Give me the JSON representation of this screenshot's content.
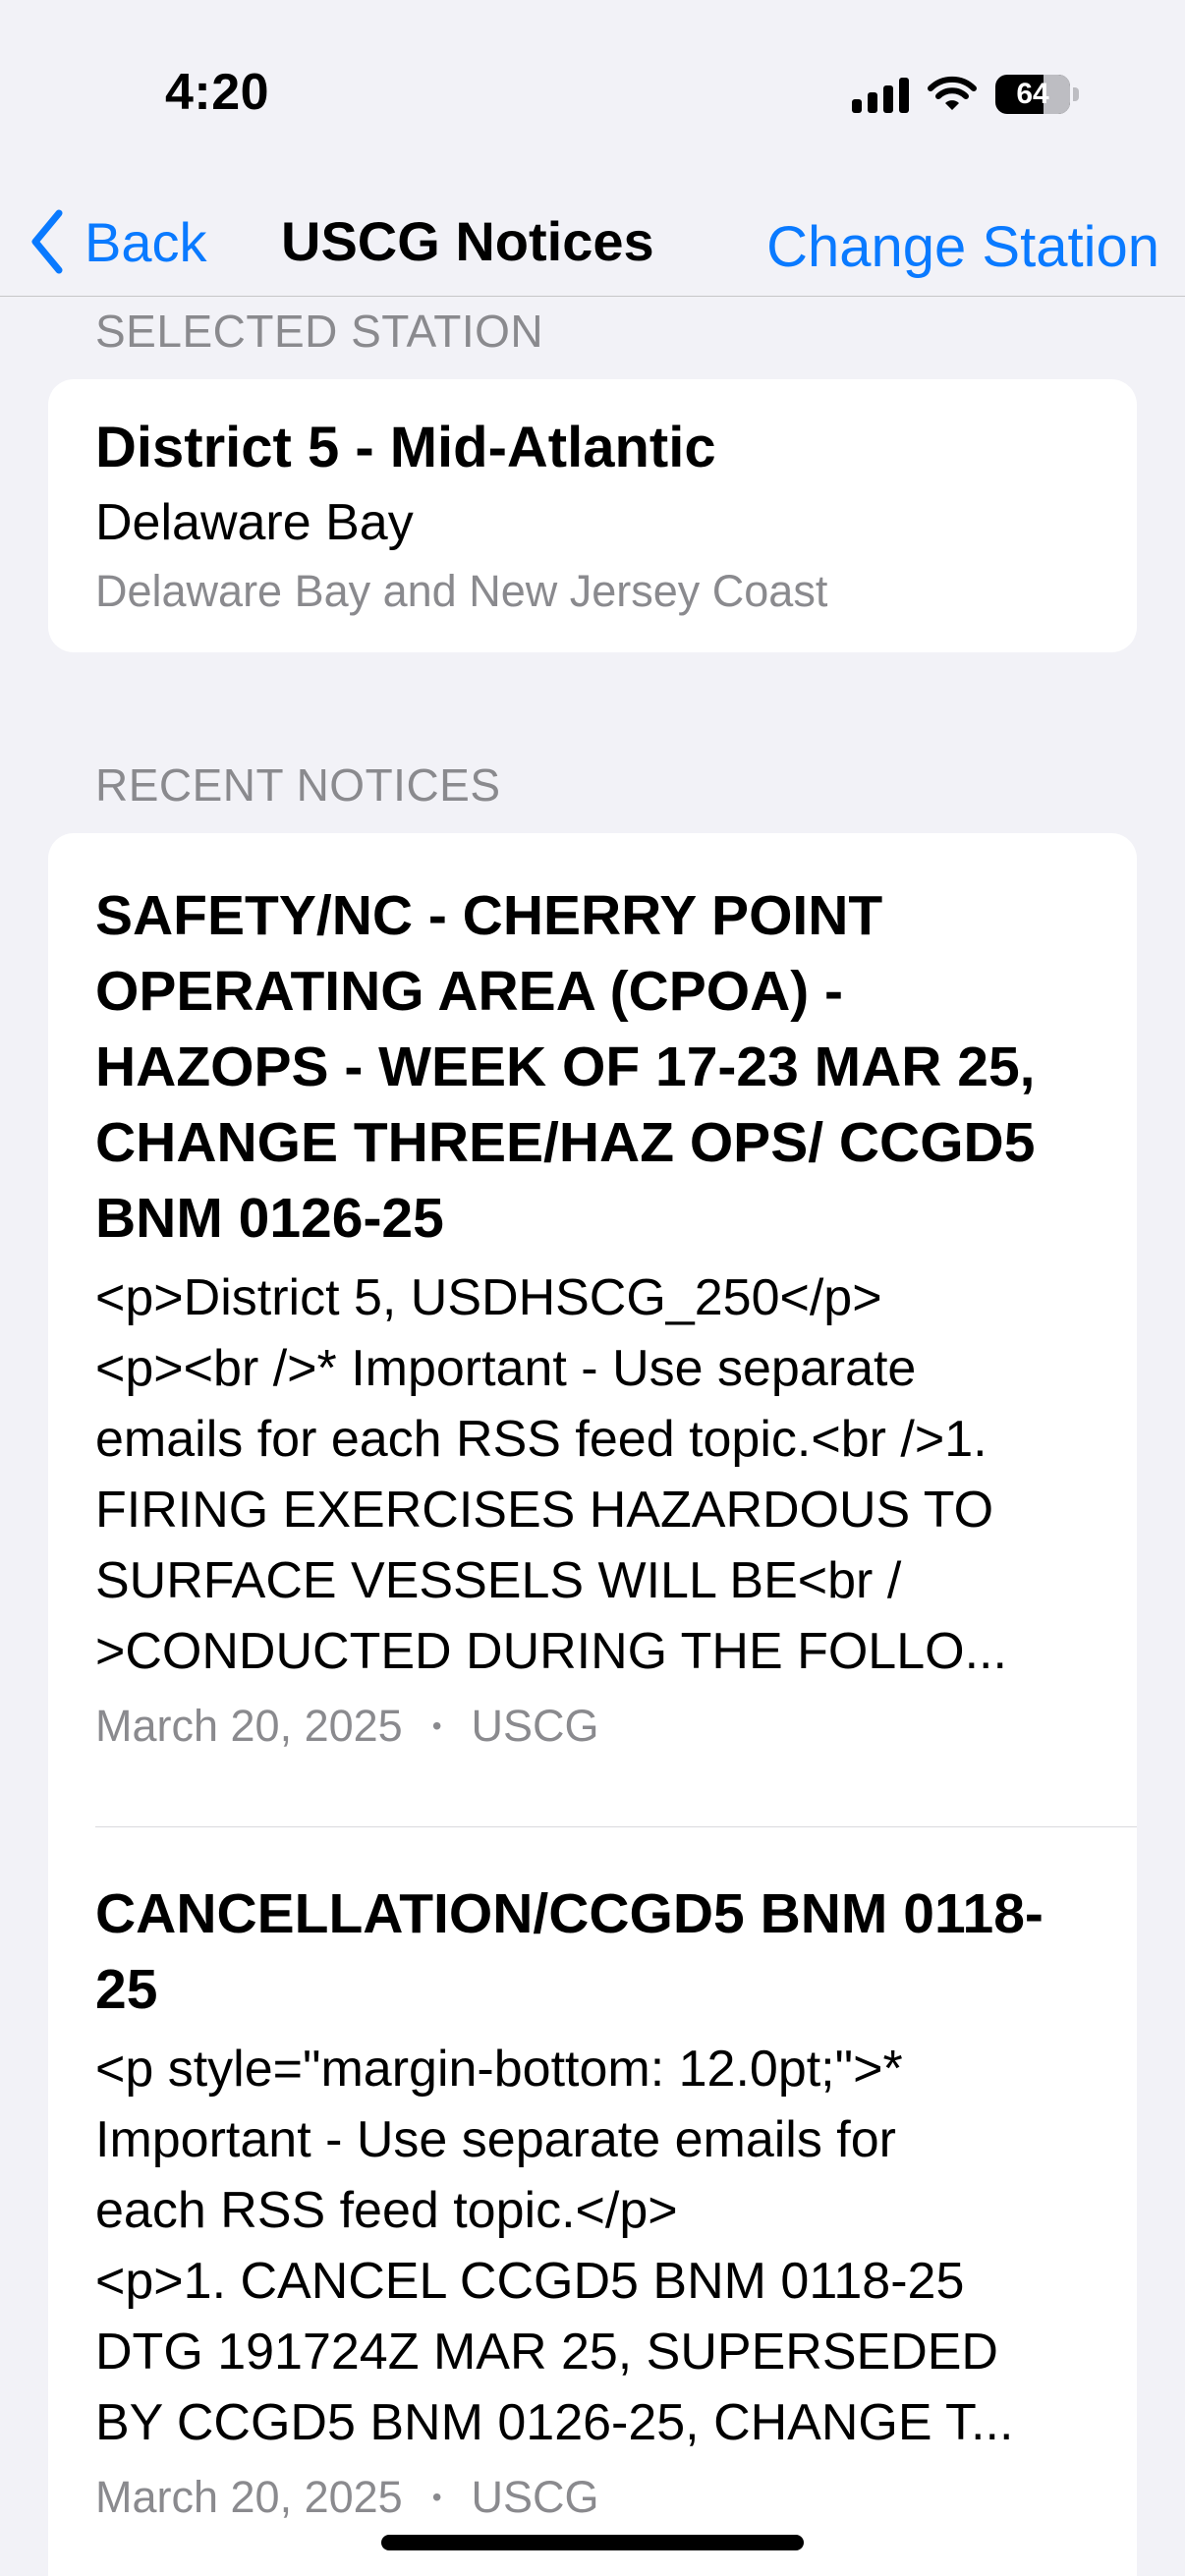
{
  "status_bar": {
    "time": "4:20",
    "battery": "64",
    "battery_level_percent": 64
  },
  "nav": {
    "back_label": "Back",
    "title": "USCG Notices",
    "change_station_label": "Change Station"
  },
  "selected_station": {
    "header": "SELECTED STATION",
    "name": "District 5 - Mid-Atlantic",
    "area": "Delaware Bay",
    "description": "Delaware Bay and New Jersey Coast"
  },
  "recent_notices": {
    "header": "RECENT NOTICES",
    "items": [
      {
        "title": "SAFETY/NC - CHERRY POINT OPERATING AREA (CPOA) - HAZOPS - WEEK OF 17-23 MAR 25, CHANGE THREE/HAZ OPS/ CCGD5 BNM 0126-25",
        "body_lines": [
          "<p>District 5, USDHSCG_250</p>",
          "<p><br />* Important - Use separate",
          "emails for each RSS feed topic.<br />1.",
          "FIRING EXERCISES HAZARDOUS TO",
          "SURFACE VESSELS WILL BE<br /",
          ">CONDUCTED DURING THE FOLLO..."
        ],
        "date": "March 20, 2025",
        "source": "USCG"
      },
      {
        "title": "CANCELLATION/CCGD5 BNM 0118-25",
        "body_lines": [
          "<p style=\"margin-bottom: 12.0pt;\">*",
          "Important - Use separate emails for",
          "each RSS feed topic.</p>",
          "<p>1. CANCEL CCGD5 BNM 0118-25",
          "DTG 191724Z MAR 25, SUPERSEDED",
          "BY CCGD5 BNM 0126-25, CHANGE T..."
        ],
        "date": "March 20, 2025",
        "source": "USCG"
      }
    ]
  },
  "meta_separator": "•",
  "colors": {
    "accent": "#0a7aff",
    "background": "#f2f2f7",
    "secondary_text": "#8a8a8e"
  }
}
